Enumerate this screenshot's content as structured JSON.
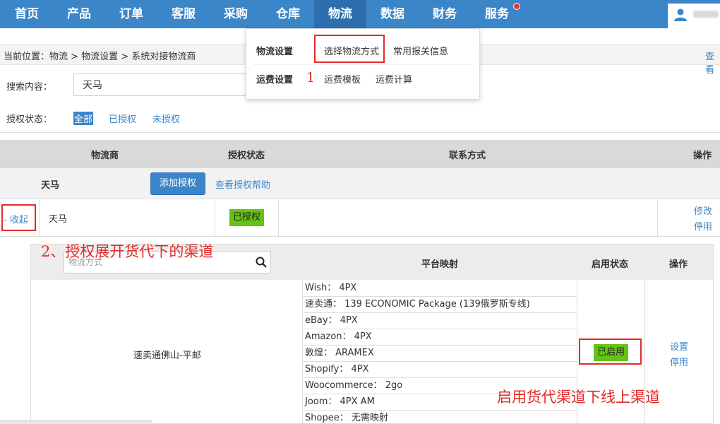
{
  "nav": {
    "items": [
      "首页",
      "产品",
      "订单",
      "客服",
      "采购",
      "仓库",
      "物流",
      "数据",
      "财务",
      "服务"
    ],
    "active": "物流"
  },
  "dropdown": {
    "group1": "物流设置",
    "link_select": "选择物流方式",
    "link_customs": "常用报关信息",
    "group2": "运费设置",
    "link_template": "运费模板",
    "link_calc": "运费计算",
    "annotation_1": "1"
  },
  "breadcrumb": {
    "text": "当前位置：物流 > 物流设置 > 系统对接物流商",
    "right": "查看"
  },
  "search": {
    "label": "搜索内容：",
    "value": "天马"
  },
  "auth_filter": {
    "label": "授权状态：",
    "options": [
      "全部",
      "已授权",
      "未授权"
    ],
    "selected": "全部"
  },
  "table": {
    "headers": [
      "物流商",
      "授权状态",
      "联系方式",
      "操作"
    ],
    "carrier_name": "天马",
    "add_button": "添加授权",
    "help_link": "查看授权帮助",
    "detail": {
      "collapse": "- 收起",
      "name": "天马",
      "auth_status": "已授权",
      "op_edit": "修改",
      "op_disable": "停用"
    }
  },
  "channels": {
    "search_placeholder": "物流方式",
    "headers": [
      "平台映射",
      "启用状态",
      "操作"
    ],
    "name": "速卖通佛山-平邮",
    "mappings": [
      "Wish：  4PX",
      "速卖通：  139 ECONOMIC Package (139俄罗斯专线)",
      "eBay：  4PX",
      "Amazon：  4PX",
      "敦煌：  ARAMEX",
      "Shopify：  4PX",
      "Woocommerce：  2go",
      "Joom：  4PX AM",
      "Shopee：  无需映射"
    ],
    "status": "已启用",
    "op_settings": "设置",
    "op_disable": "停用"
  },
  "annotations": {
    "step2": "2、授权展开货代下的渠道",
    "step3": "启用货代渠道下线上渠道"
  },
  "colors": {
    "nav_bg": "#3b86c9",
    "nav_active": "#2d6fae",
    "link": "#3b86c9",
    "badge_green": "#66c217",
    "annotation_red": "#e02b2b"
  }
}
